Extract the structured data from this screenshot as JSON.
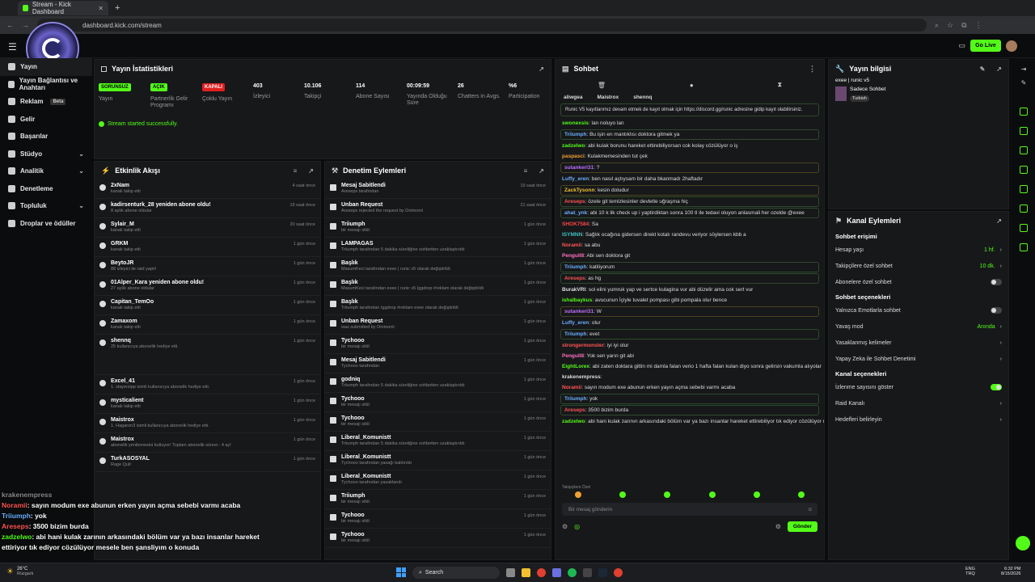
{
  "browser": {
    "tab_title": "Stream - Kick Dashboard",
    "url": "dashboard.kick.com/stream"
  },
  "topbar": {
    "go_live": "Go Live"
  },
  "sidebar": {
    "items": [
      {
        "label": "Yayın",
        "chev": false
      },
      {
        "label": "Yayın Bağlantısı ve Anahtarı",
        "chev": false
      },
      {
        "label": "Reklam",
        "badge": "Beta",
        "chev": false
      },
      {
        "label": "Gelir",
        "chev": false
      },
      {
        "label": "Başarılar",
        "chev": false
      },
      {
        "label": "Stüdyo",
        "chev": true
      },
      {
        "label": "Analitik",
        "chev": true
      },
      {
        "label": "Denetleme",
        "chev": false
      },
      {
        "label": "Topluluk",
        "chev": true
      },
      {
        "label": "Droplar ve ödüller",
        "chev": false
      }
    ]
  },
  "stats": {
    "title": "Yayın İstatistikleri",
    "items": [
      {
        "value": "SORUNSUZ",
        "label": "Yayın",
        "tag": "green"
      },
      {
        "value": "AÇIK",
        "label": "Partnerlik Gelir Programı",
        "tag": "green"
      },
      {
        "value": "KAPALI",
        "label": "Çoklu Yayın",
        "tag": "red"
      },
      {
        "value": "403",
        "label": "İzleyici"
      },
      {
        "value": "10.106",
        "label": "Takipçi"
      },
      {
        "value": "114",
        "label": "Abone Sayısı"
      },
      {
        "value": "00:09:59",
        "label": "Yayında Olduğu Süre"
      },
      {
        "value": "26",
        "label": "Chatters in Avgs."
      },
      {
        "value": "%6",
        "label": "Participation"
      }
    ],
    "status": "Stream started successfully."
  },
  "activity": {
    "title": "Etkinlik Akışı",
    "rows": [
      {
        "name": "2xNam",
        "sub": "kanalı takip etti",
        "time": "4 saat önce"
      },
      {
        "name": "kadirsenturk_28 yeniden abone oldu!",
        "sub": "8 aylık abone oldular",
        "time": "19 saat önce"
      },
      {
        "name": "Sylair_M",
        "sub": "kanalı takip etti",
        "time": "20 saat önce"
      },
      {
        "name": "GRKM",
        "sub": "kanalı takip etti",
        "time": "1 gün önce"
      },
      {
        "name": "BeytoJR",
        "sub": "88 izleyici ile raid yaptı!",
        "time": "1 gün önce"
      },
      {
        "name": "01Alper_Kara yeniden abone oldu!",
        "sub": "27 aylık abone oldular",
        "time": "1 gün önce"
      },
      {
        "name": "Capitan_TemOo",
        "sub": "kanalı takip etti",
        "time": "1 gün önce"
      },
      {
        "name": "Zamaxom",
        "sub": "kanalı takip etti",
        "time": "1 gün önce"
      },
      {
        "name": "shennq",
        "sub": "25 kullanıcıya abonelik hediye etti.",
        "time": "1 gün önce",
        "tall": true
      },
      {
        "name": "Excel_41",
        "sub": "1. slayerzipp isimli kullanıcıya abonelik hediye etti.",
        "time": "1 gün önce"
      },
      {
        "name": "mysticalient",
        "sub": "kanalı takip etti",
        "time": "1 gün önce"
      },
      {
        "name": "Maistrox",
        "sub": "1. Hagaron3 isimli kullanıcıya abonelik hediye etti.",
        "time": "1 gün önce"
      },
      {
        "name": "Maistrox",
        "sub": "abonelik yenilemesini kutluyor! Toplam abonelik süresi - 4 ay!",
        "time": "1 gün önce"
      },
      {
        "name": "TurkASOSYAL",
        "sub": "Rage Quit",
        "time": "1 gün önce"
      }
    ]
  },
  "moderation": {
    "title": "Denetim Eylemleri",
    "rows": [
      {
        "name": "Mesaj Sabitlendi",
        "sub": "Areseps tarafından",
        "time": "19 saat önce"
      },
      {
        "name": "Unban Request",
        "sub": "Areseps rejected the request by Onimonii",
        "time": "21 saat önce"
      },
      {
        "name": "Triiumph",
        "sub": "bir mesajı sildi",
        "time": "1 gün önce"
      },
      {
        "name": "LAMPAGAS",
        "sub": "Triiumph tarafından 5 dakika süreliğine sohbetten uzaklaştırıldı",
        "time": "1 gün önce"
      },
      {
        "name": "Başlık",
        "sub": "MasumKeci tarafından exee | runic v5 olarak değiştirildi",
        "time": "1 gün önce"
      },
      {
        "name": "Başlık",
        "sub": "MasumKeci tarafından exee | runic v5 Iggdrop #reklam olarak değiştirildi",
        "time": "1 gün önce"
      },
      {
        "name": "Başlık",
        "sub": "Triiumph tarafından Iggdrop #reklam exee olarak değiştirildi",
        "time": "1 gün önce"
      },
      {
        "name": "Unban Request",
        "sub": "was submitted by Onimonii",
        "time": "1 gün önce"
      },
      {
        "name": "Tychooo",
        "sub": "bir mesajı sildi",
        "time": "1 gün önce"
      },
      {
        "name": "Mesaj Sabitlendi",
        "sub": "Tychooo tarafından",
        "time": "1 gün önce"
      },
      {
        "name": "godniq",
        "sub": "Triiumph tarafından 5 dakika süreliğine sohbetten uzaklaştırıldı",
        "time": "1 gün önce"
      },
      {
        "name": "Tychooo",
        "sub": "bir mesajı sildi",
        "time": "1 gün önce"
      },
      {
        "name": "Tychooo",
        "sub": "bir mesajı sildi",
        "time": "1 gün önce"
      },
      {
        "name": "Liberal_Komunistt",
        "sub": "Triiumph tarafından 5 dakika süreliğine sohbetten uzaklaştırıldı",
        "time": "1 gün önce"
      },
      {
        "name": "Liberal_Komunistt",
        "sub": "Tychooo tarafından yasağı kaldırıldı",
        "time": "1 gün önce"
      },
      {
        "name": "Liberal_Komunistt",
        "sub": "Tychooo tarafından yasaklandı",
        "time": "1 gün önce"
      },
      {
        "name": "Triiumph",
        "sub": "bir mesajı sildi",
        "time": "1 gün önce"
      },
      {
        "name": "Tychooo",
        "sub": "bir mesajı sildi",
        "time": "1 gün önce"
      },
      {
        "name": "Tychooo",
        "sub": "bir mesajı sildi",
        "time": "1 gün önce"
      }
    ]
  },
  "chat": {
    "title": "Sohbet",
    "top_users": [
      "aliwgea",
      "Maistrox",
      "shennq"
    ],
    "pinned": "Runic V5 kayıtlarımız devam etmek de kayıt olmak için https://discord.gg/runic adresine gidip kayıt olabilirsiniz.",
    "messages": [
      {
        "u": "swonexsis",
        "t": ": lan noluyo lan",
        "c": "#53fc18"
      },
      {
        "u": "Triiumph",
        "t": ": Bu işin en mantıklısı doktora gitmek ya",
        "c": "#6ab0ff",
        "box": "hl"
      },
      {
        "u": "zadzelwo",
        "t": ": abi kulak borunu hareket ettirebiliyorsan cok kolay cözülüyor o iş",
        "c": "#53fc18"
      },
      {
        "u": "paspasci",
        "t": ": Kulakmemesinden tut çek",
        "c": "#f0a030"
      },
      {
        "u": "sutankeri31",
        "t": ": ?",
        "c": "#c070ff",
        "box": "rp"
      },
      {
        "u": "Luffy_eren",
        "t": ": ben nasıl açtıysam bir daha bkanmadı 2haftadır",
        "c": "#6ab0ff"
      },
      {
        "u": "ZackTysonn",
        "t": ": kesin doludur",
        "c": "#f0c030",
        "box": "rp"
      },
      {
        "u": "Areseps",
        "t": ": özele git temizlesinler devletle uğraşma hiç",
        "c": "#ff5555",
        "box": "hl"
      },
      {
        "u": "ahat_ynk",
        "t": ": abi 10 k lik check up i yaptirdiktan sonra 100 tl ile tedavi oluyon anlasmali her ozelde @exee",
        "c": "#6ab0ff",
        "box": "hl"
      },
      {
        "u": "SHOK7584",
        "t": ": Sa",
        "c": "#ff4444"
      },
      {
        "u": "ISYMNN",
        "t": ": Sağlık ocağına gidersen direkt kotalı randevu veriyor söylersen kbb a",
        "c": "#40c0c0"
      },
      {
        "u": "Noramii",
        "t": ": sa abu",
        "c": "#ff5555"
      },
      {
        "u": "Pengull8",
        "t": ": Abi sen doktora git",
        "c": "#ff70c0"
      },
      {
        "u": "Triiumph",
        "t": ": katiliyorum",
        "c": "#6ab0ff",
        "box": "hl"
      },
      {
        "u": "Areseps",
        "t": ": as hg",
        "c": "#ff5555",
        "box": "hl"
      },
      {
        "u": "BurakVRI",
        "t": ": sol elini yumruk yap ve sertce kulagina vur abi düzelir ama cok sert vur",
        "c": "#ddd"
      },
      {
        "u": "ishalbaykus",
        "t": ": avucunun İçiyle tuvalet pompası gibi pompala olur bence",
        "c": "#53fc18"
      },
      {
        "u": "sutankeri31",
        "t": ": W",
        "c": "#c070ff",
        "box": "rp"
      },
      {
        "u": "Luffy_eren",
        "t": ": olur",
        "c": "#6ab0ff"
      },
      {
        "u": "Triiumph",
        "t": ": evet",
        "c": "#6ab0ff",
        "box": "hl"
      },
      {
        "u": "strongermonster",
        "t": ": iyi iyi olur",
        "c": "#ff5555"
      },
      {
        "u": "Pengull8",
        "t": ": Yok sen yarın git abi",
        "c": "#ff70c0"
      },
      {
        "u": "EightLorex",
        "t": ": abi zaten doktara gittin mi damla falan verio 1 hafta falan kulan diyo sonra gelirsin vakumla alıyolar",
        "c": "#53fc18"
      },
      {
        "u": "krakenempress",
        "t": ":",
        "c": "#ddd"
      },
      {
        "u": "Noramii",
        "t": ": sayın modum exe abunun erken yayın açma sebebi varmı acaba",
        "c": "#ff5555"
      },
      {
        "u": "Triiumph",
        "t": ": yok",
        "c": "#6ab0ff",
        "box": "hl"
      },
      {
        "u": "Areseps",
        "t": ": 3500 bizim burda",
        "c": "#ff5555",
        "box": "hl"
      },
      {
        "u": "zadzelwo",
        "t": ": abi hani kulak zarının arkasındaki bölüm var ya bazı insanlar hareket ettirebiliyor tık ediyor cözülüyor mesele ben şansliyım o konuda",
        "c": "#53fc18"
      }
    ],
    "followers_label": "Takipçilere Özel",
    "input_placeholder": "Bir mesaj gönderin",
    "send": "Gönder"
  },
  "stream_info": {
    "title": "Yayın bilgisi",
    "stream_title": "exee | runic v5",
    "category": "Sadece Sohbet",
    "tag": "Turkish"
  },
  "channel_actions": {
    "title": "Kanal Eylemleri",
    "chat_access": "Sohbet erişimi",
    "rows1": [
      {
        "label": "Hesap yaşı",
        "value": "1 hf."
      },
      {
        "label": "Takipçilere özel sohbet",
        "value": "10 dk."
      },
      {
        "label": "Abonelere özel sohbet",
        "toggle": false
      }
    ],
    "chat_options": "Sohbet seçenekleri",
    "rows2": [
      {
        "label": "Yalnızca Emotlarla sohbet",
        "toggle": false
      },
      {
        "label": "Yavaş mod",
        "value": "Anında"
      },
      {
        "label": "Yasaklanmış kelimeler"
      },
      {
        "label": "Yapay Zeka ile Sohbet Denetimi"
      }
    ],
    "channel_options": "Kanal seçenekleri",
    "rows3": [
      {
        "label": "İzlenme sayısını göster",
        "toggle": true
      },
      {
        "label": "Raid Kanalı"
      },
      {
        "label": "Hedefleri belirleyin"
      }
    ]
  },
  "overlay_chat": [
    {
      "u": "krakenempress",
      "t": "",
      "c": "#888"
    },
    {
      "u": "Noramii",
      "t": ": sayın modum exe abunun erken yayın açma sebebi varmı acaba",
      "c": "#ff5555"
    },
    {
      "u": "Triiumph",
      "t": ": yok",
      "c": "#6ab0ff"
    },
    {
      "u": "Areseps",
      "t": ": 3500 bizim burda",
      "c": "#ff5555"
    },
    {
      "u": "zadzelwo",
      "t": ": abi hani kulak zarının arkasındaki bölüm var ya bazı insanlar hareket ettiriyor tık ediyor cözülüyor mesele ben şansliyım o konuda",
      "c": "#53fc18"
    }
  ],
  "taskbar": {
    "weather_temp": "26°C",
    "weather_desc": "Rüzgarlı",
    "search": "Search",
    "lang": "ENG",
    "lang2": "TRQ",
    "time": "6:32 PM",
    "date": "8/15/2026"
  }
}
